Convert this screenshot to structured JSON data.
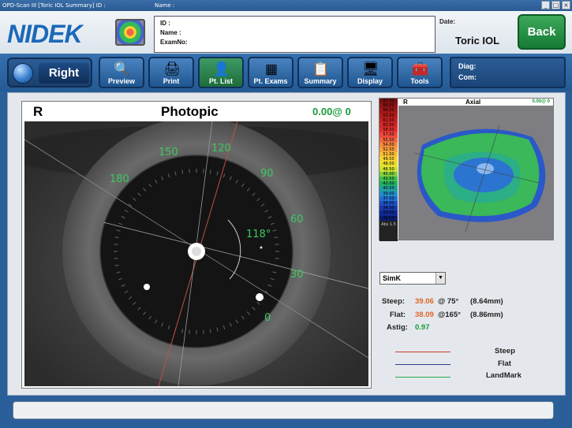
{
  "window": {
    "title": "OPD-Scan III [Toric IOL Summary] ID :",
    "name_label": "Name :",
    "buttons": [
      "_",
      "□",
      "×"
    ]
  },
  "header": {
    "logo": "NIDEK",
    "id_label": "ID :",
    "name_label": "Name :",
    "examno_label": "ExamNo:",
    "date_label": "Date:",
    "page_name": "Toric IOL",
    "back_label": "Back"
  },
  "toolbar": {
    "side": "Right",
    "buttons": [
      {
        "label": "Preview",
        "icon": "preview-icon"
      },
      {
        "label": "Print",
        "icon": "printer-icon"
      },
      {
        "label": "Pt. List",
        "icon": "patient-icon"
      },
      {
        "label": "Pt. Exams",
        "icon": "exams-icon"
      },
      {
        "label": "Summary",
        "icon": "summary-icon"
      },
      {
        "label": "Display",
        "icon": "display-icon"
      },
      {
        "label": "Tools",
        "icon": "tools-icon"
      }
    ],
    "diag_label": "Diag:",
    "com_label": "Com:"
  },
  "eye_view": {
    "eye": "R",
    "title": "Photopic",
    "value": "0.00@  0",
    "degree_labels": [
      "150",
      "120",
      "180",
      "90",
      "60",
      "30",
      "0"
    ],
    "angle_label": "118°"
  },
  "map": {
    "eye": "R",
    "title": "Axial",
    "value": "0.00@  0",
    "scale": [
      "67.50",
      "66.00",
      "64.50",
      "63.00",
      "61.50",
      "60.00",
      "58.50",
      "57.00",
      "55.50",
      "54.00",
      "52.50",
      "51.00",
      "49.50",
      "48.00",
      "46.50",
      "45.00",
      "43.50",
      "42.00",
      "40.50",
      "39.00",
      "37.50",
      "36.00",
      "34.50",
      "33.00",
      "31.50"
    ],
    "scale_colors": [
      "#7a1010",
      "#8e1414",
      "#a01818",
      "#b41c1c",
      "#c42222",
      "#d42828",
      "#e43030",
      "#ee4a3a",
      "#f06a40",
      "#f48a40",
      "#f6a23c",
      "#f8bc38",
      "#f6d434",
      "#e8e030",
      "#c8e030",
      "#80d040",
      "#40c050",
      "#20b060",
      "#20a0a0",
      "#2090c8",
      "#2070d0",
      "#2050c0",
      "#1838a8",
      "#102890",
      "#081c70"
    ],
    "scale_footer": "Abs 1.5"
  },
  "simk": {
    "selected": "SimK",
    "steep_label": "Steep:",
    "steep_value": "39.06",
    "steep_axis": "@ 75°",
    "steep_mm": "(8.64mm)",
    "flat_label": "Flat:",
    "flat_value": "38.09",
    "flat_axis": "@165°",
    "flat_mm": "(8.86mm)",
    "astig_label": "Astig:",
    "astig_value": "0.97"
  },
  "legend": [
    {
      "label": "Steep",
      "color": "#cc3a2a"
    },
    {
      "label": "Flat",
      "color": "#2a3a8a"
    },
    {
      "label": "LandMark",
      "color": "#2aa84a"
    }
  ]
}
